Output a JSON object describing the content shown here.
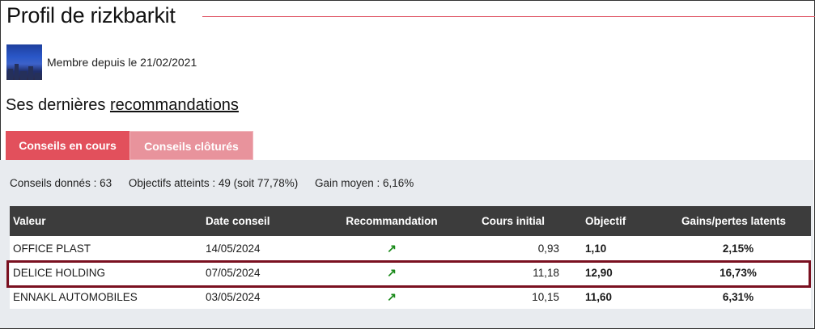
{
  "profile": {
    "title": "Profil de rizkbarkit",
    "member_since": "Membre depuis le 21/02/2021"
  },
  "section": {
    "heading_prefix": "Ses dernières ",
    "heading_link": "recommandations"
  },
  "tabs": [
    {
      "label": "Conseils en cours",
      "active": true
    },
    {
      "label": "Conseils clôturés",
      "active": false
    }
  ],
  "stats": {
    "given": "Conseils donnés : 63",
    "reached": "Objectifs atteints : 49 (soit 77,78%)",
    "avg_gain": "Gain moyen : 6,16%"
  },
  "table": {
    "headers": [
      "Valeur",
      "Date conseil",
      "Recommandation",
      "Cours initial",
      "Objectif",
      "Gains/pertes latents"
    ],
    "rows": [
      {
        "valeur": "OFFICE PLAST",
        "date": "14/05/2024",
        "reco": "↗",
        "cours": "0,93",
        "objectif": "1,10",
        "gain": "2,15%"
      },
      {
        "valeur": "DELICE HOLDING",
        "date": "07/05/2024",
        "reco": "↗",
        "cours": "11,18",
        "objectif": "12,90",
        "gain": "16,73%"
      },
      {
        "valeur": "ENNAKL AUTOMOBILES",
        "date": "03/05/2024",
        "reco": "↗",
        "cours": "10,15",
        "objectif": "11,60",
        "gain": "6,31%"
      }
    ]
  },
  "colors": {
    "accent": "#e2505c",
    "gain": "#2ee02e",
    "header_bg": "#3c3c3c",
    "highlight": "#7a1020"
  }
}
